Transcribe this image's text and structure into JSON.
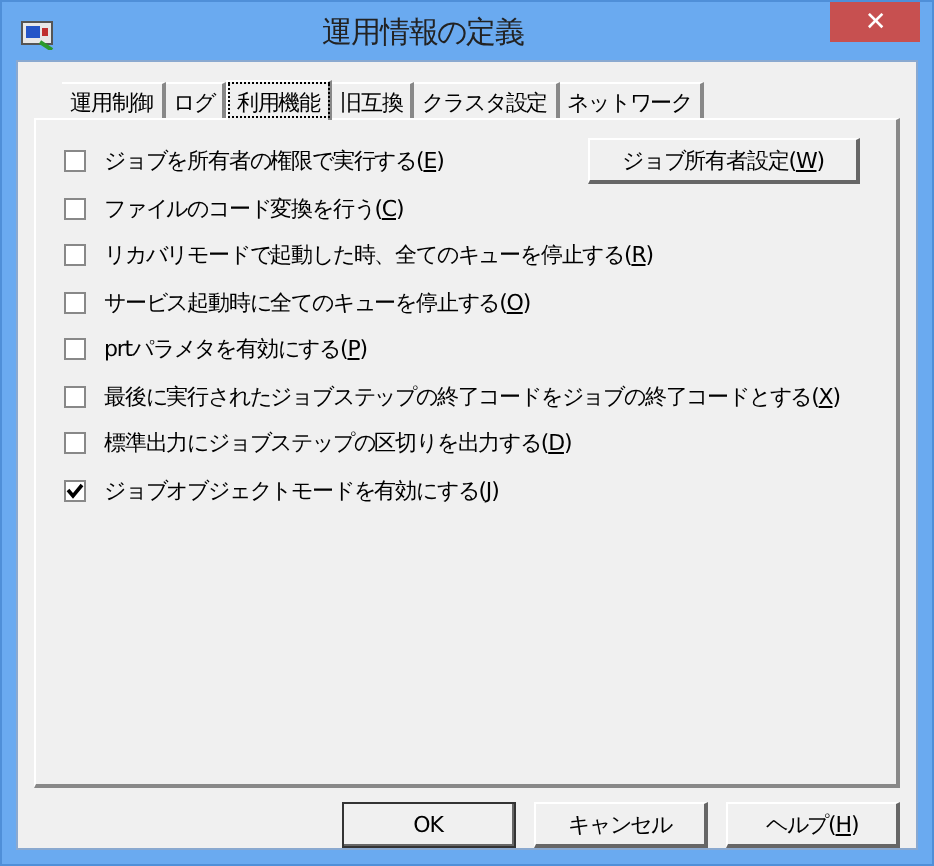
{
  "window": {
    "title": "運用情報の定義",
    "close": "✕"
  },
  "tabs": [
    {
      "label": "運用制御",
      "selected": false
    },
    {
      "label": "ログ",
      "selected": false
    },
    {
      "label": "利用機能",
      "selected": true
    },
    {
      "label": "旧互換",
      "selected": false
    },
    {
      "label": "クラスタ設定",
      "selected": false
    },
    {
      "label": "ネットワーク",
      "selected": false
    }
  ],
  "options": [
    {
      "label": "ジョブを所有者の権限で実行する(E)",
      "checked": false,
      "button": "ジョブ所有者設定(W)"
    },
    {
      "label": "ファイルのコード変換を行う(C)",
      "checked": false
    },
    {
      "label": "リカバリモードで起動した時、全てのキューを停止する(R)",
      "checked": false
    },
    {
      "label": "サービス起動時に全てのキューを停止する(O)",
      "checked": false
    },
    {
      "label": "prtパラメタを有効にする(P)",
      "checked": false
    },
    {
      "label": "最後に実行されたジョブステップの終了コードをジョブの終了コードとする(X)",
      "checked": false
    },
    {
      "label": "標準出力にジョブステップの区切りを出力する(D)",
      "checked": false
    },
    {
      "label": "ジョブオブジェクトモードを有効にする(J)",
      "checked": true
    }
  ],
  "buttons": [
    "OK",
    "キャンセル",
    "ヘルプ(H)"
  ]
}
